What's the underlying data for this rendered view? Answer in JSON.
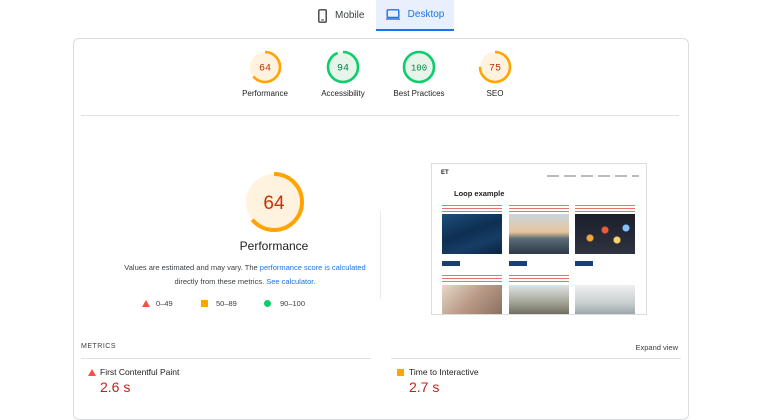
{
  "tabs": {
    "mobile": "Mobile",
    "desktop": "Desktop",
    "active": "Desktop"
  },
  "summary_gauges": [
    {
      "score": "64",
      "label": "Performance",
      "fraction": 0.64,
      "color": "#ffa400",
      "bg": "#fff3e0",
      "text_color": "#c33300"
    },
    {
      "score": "94",
      "label": "Accessibility",
      "fraction": 0.94,
      "color": "#0cce6b",
      "bg": "#e6f4ea",
      "text_color": "#018642"
    },
    {
      "score": "100",
      "label": "Best Practices",
      "fraction": 1.0,
      "color": "#0cce6b",
      "bg": "#e6f4ea",
      "text_color": "#018642"
    },
    {
      "score": "75",
      "label": "SEO",
      "fraction": 0.75,
      "color": "#ffa400",
      "bg": "#fff3e0",
      "text_color": "#c33300"
    }
  ],
  "performance": {
    "score": "64",
    "fraction": 0.64,
    "title": "Performance",
    "note_prefix": "Values are estimated and may vary. The",
    "note_link1": "performance score is calculated",
    "note_mid": "directly from these metrics.",
    "note_link2": "See calculator."
  },
  "legend": {
    "fail": "0–49",
    "average": "50–89",
    "pass": "90–100"
  },
  "screenshot": {
    "brand": "ET",
    "heading": "Loop example"
  },
  "metrics": {
    "header": "METRICS",
    "expand": "Expand view",
    "items": [
      {
        "name": "First Contentful Paint",
        "value": "2.6 s",
        "status": "fail"
      },
      {
        "name": "Time to Interactive",
        "value": "2.7 s",
        "status": "average"
      }
    ]
  },
  "colors": {
    "accent": "#1a73e8",
    "fail": "#ff4e42",
    "average": "#ffa400",
    "pass": "#0cce6b"
  }
}
